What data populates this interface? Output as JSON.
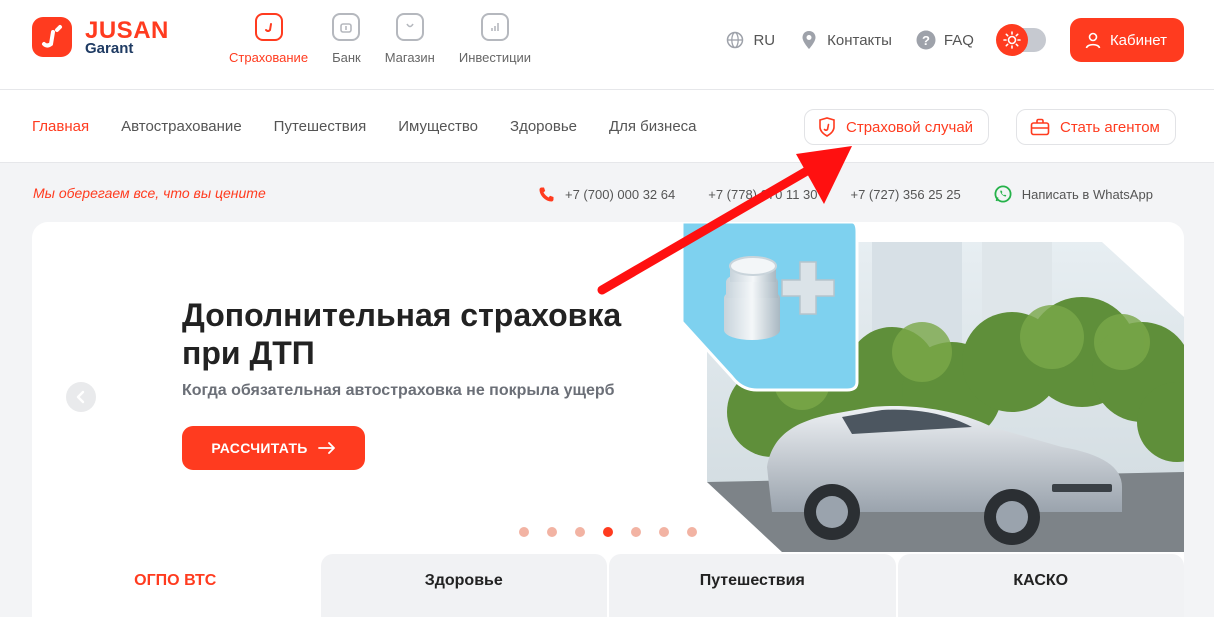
{
  "brand": {
    "name": "JUSAN",
    "sub": "Garant"
  },
  "main_nav": [
    {
      "label": "Страхование",
      "icon": "shield-icon",
      "active": true
    },
    {
      "label": "Банк",
      "icon": "bank-icon",
      "active": false
    },
    {
      "label": "Магазин",
      "icon": "shopping-bag-icon",
      "active": false
    },
    {
      "label": "Инвестиции",
      "icon": "chart-icon",
      "active": false
    }
  ],
  "top_right": {
    "language": "RU",
    "contacts": "Контакты",
    "faq": "FAQ",
    "cabinet": "Кабинет"
  },
  "sub_nav": [
    {
      "label": "Главная",
      "active": true
    },
    {
      "label": "Автострахование",
      "active": false
    },
    {
      "label": "Путешествия",
      "active": false
    },
    {
      "label": "Имущество",
      "active": false
    },
    {
      "label": "Здоровье",
      "active": false
    },
    {
      "label": "Для бизнеса",
      "active": false
    }
  ],
  "sub_buttons": {
    "insurance_case": "Страховой случай",
    "become_agent": "Стать агентом"
  },
  "info": {
    "tagline": "Мы оберегаем все, что вы цените",
    "phone1": "+7 (700) 000 32 64",
    "phone2": "+7 (778) 070 11 30",
    "phone3": "+7 (727) 356 25 25",
    "whatsapp": "Написать в WhatsApp"
  },
  "hero": {
    "title": "Дополнительная страховка при ДТП",
    "subtitle": "Когда обязательная автостраховка не покрыла ущерб",
    "cta": "РАССЧИТАТЬ",
    "slide_count": 7,
    "active_slide": 4
  },
  "tabs": [
    {
      "label": "ОГПО ВТС",
      "active": true
    },
    {
      "label": "Здоровье",
      "active": false
    },
    {
      "label": "Путешествия",
      "active": false
    },
    {
      "label": "КАСКО",
      "active": false
    }
  ],
  "colors": {
    "accent": "#ff3b1f",
    "navy": "#1f3b63",
    "bg": "#f3f4f6"
  }
}
